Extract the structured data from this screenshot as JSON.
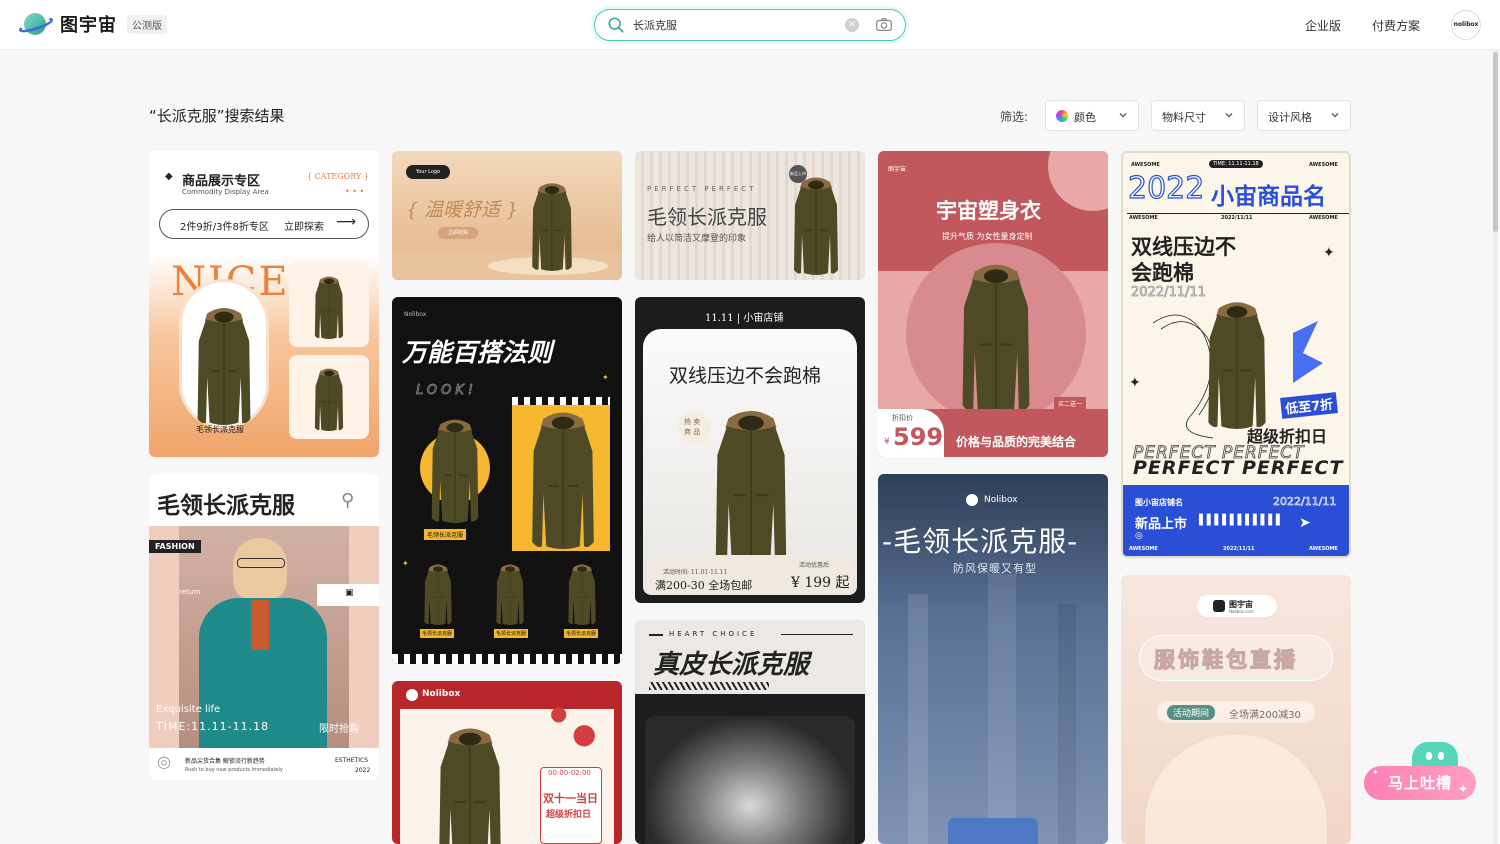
{
  "header": {
    "logo_text": "图宇宙",
    "beta_badge": "公测版",
    "search_value": "长派克服",
    "nav": [
      "企业版",
      "付费方案"
    ],
    "avatar_text": "nolibox"
  },
  "results": {
    "title": "“长派克服”搜索结果",
    "filter_label": "筛选:",
    "filters": [
      "颜色",
      "物料尺寸",
      "设计风格"
    ]
  },
  "cards": {
    "c1": {
      "title": "商品展示专区",
      "subtitle": "Commodity Display Area",
      "category": "{ CATEGORY }",
      "promo": "2件9折/3件8折专区",
      "cta": "立即探索",
      "nice": "NICE",
      "caption": "毛领长派克服"
    },
    "c2": {
      "logo": "Your Logo",
      "title": "{ 温暖舒适 }",
      "button": "立即抢购"
    },
    "c3": {
      "eyebrow": "PERFECT  PERFECT",
      "title": "毛领长派克服",
      "subtitle": "给人以简洁又摩登的印象",
      "badge": "新品上市"
    },
    "c4": {
      "brand": "图宇宙",
      "title": "宇宙塑身衣",
      "subtitle": "提升气质 为女性量身定制",
      "tag": "买二送一",
      "price_label": "折扣价",
      "price_symbol": "¥",
      "price": "599",
      "slogan": "价格与品质的完美结合"
    },
    "c5": {
      "top_left": "AWESOME",
      "top_mid": "TIME: 11.11-11.18",
      "top_right": "AWESOME",
      "year_title": "2022",
      "name_title": "小宙商品名",
      "date_line": "2022/11/11",
      "headline1": "双线压边不",
      "headline2": "会跑棉",
      "date_outline": "2022/11/11",
      "discount": "低至7折",
      "super": "超级折扣日",
      "perfect_outline": "PERFECT PERFECT",
      "perfect": "PERFECT PERFECT",
      "shop_name": "图小宙店铺名",
      "new_arrival": "新品上市",
      "date_blue": "2022/11/11",
      "footer_left": "AWESOME",
      "footer_mid": "2022/11/11",
      "footer_right": "AWESOME"
    },
    "c6": {
      "brand": "Nolibox",
      "title": "万能百搭法则",
      "look": "LOOK!",
      "label": "毛领长派克服",
      "small_labels": [
        "毛领长派克服",
        "毛领长派克服",
        "毛领长派克服"
      ]
    },
    "c7": {
      "header": "11.11 | 小宙店铺",
      "title": "双线压边不会跑棉",
      "hot1": "热 卖",
      "hot2": "商 品",
      "activity_time": "活动时间: 11.01-11.11",
      "deal": "满200-30 全场包邮",
      "after": "活动优惠后",
      "price": "¥ 199 起"
    },
    "c8": {
      "title": "毛领长派克服",
      "fashion": "FASHION",
      "return": "return",
      "exquisite": "Exquisite life",
      "time": "TIME:11.11-11.18",
      "limited": "限时抢购",
      "footer_cn": "新品尖货合集 解锁流行新趋势",
      "footer_en": "Rush to buy new products immediately",
      "footer_right1": "ESTHETICS",
      "footer_right2": "2022"
    },
    "c9": {
      "brand": "Nolibox",
      "title": "-毛领长派克服-",
      "subtitle": "防风保暖又有型"
    },
    "c10": {
      "brand": "Nolibox",
      "time": "00:00-02:00",
      "title": "双十一当日",
      "subtitle": "超级折扣日"
    },
    "c11": {
      "eyebrow": "HEART CHOICE",
      "title": "真皮长派克服"
    },
    "c12": {
      "brand": "图宇宙",
      "brand_sub": "Nolibox.com",
      "title": "服饰鞋包直播",
      "tag": "活动期间",
      "offer": "全场满200减30"
    }
  },
  "feedback": {
    "label": "马上吐槽"
  },
  "colors": {
    "accent": "#4fc9b4",
    "coat": "#4e4a26",
    "fur": "#8a6a40"
  }
}
